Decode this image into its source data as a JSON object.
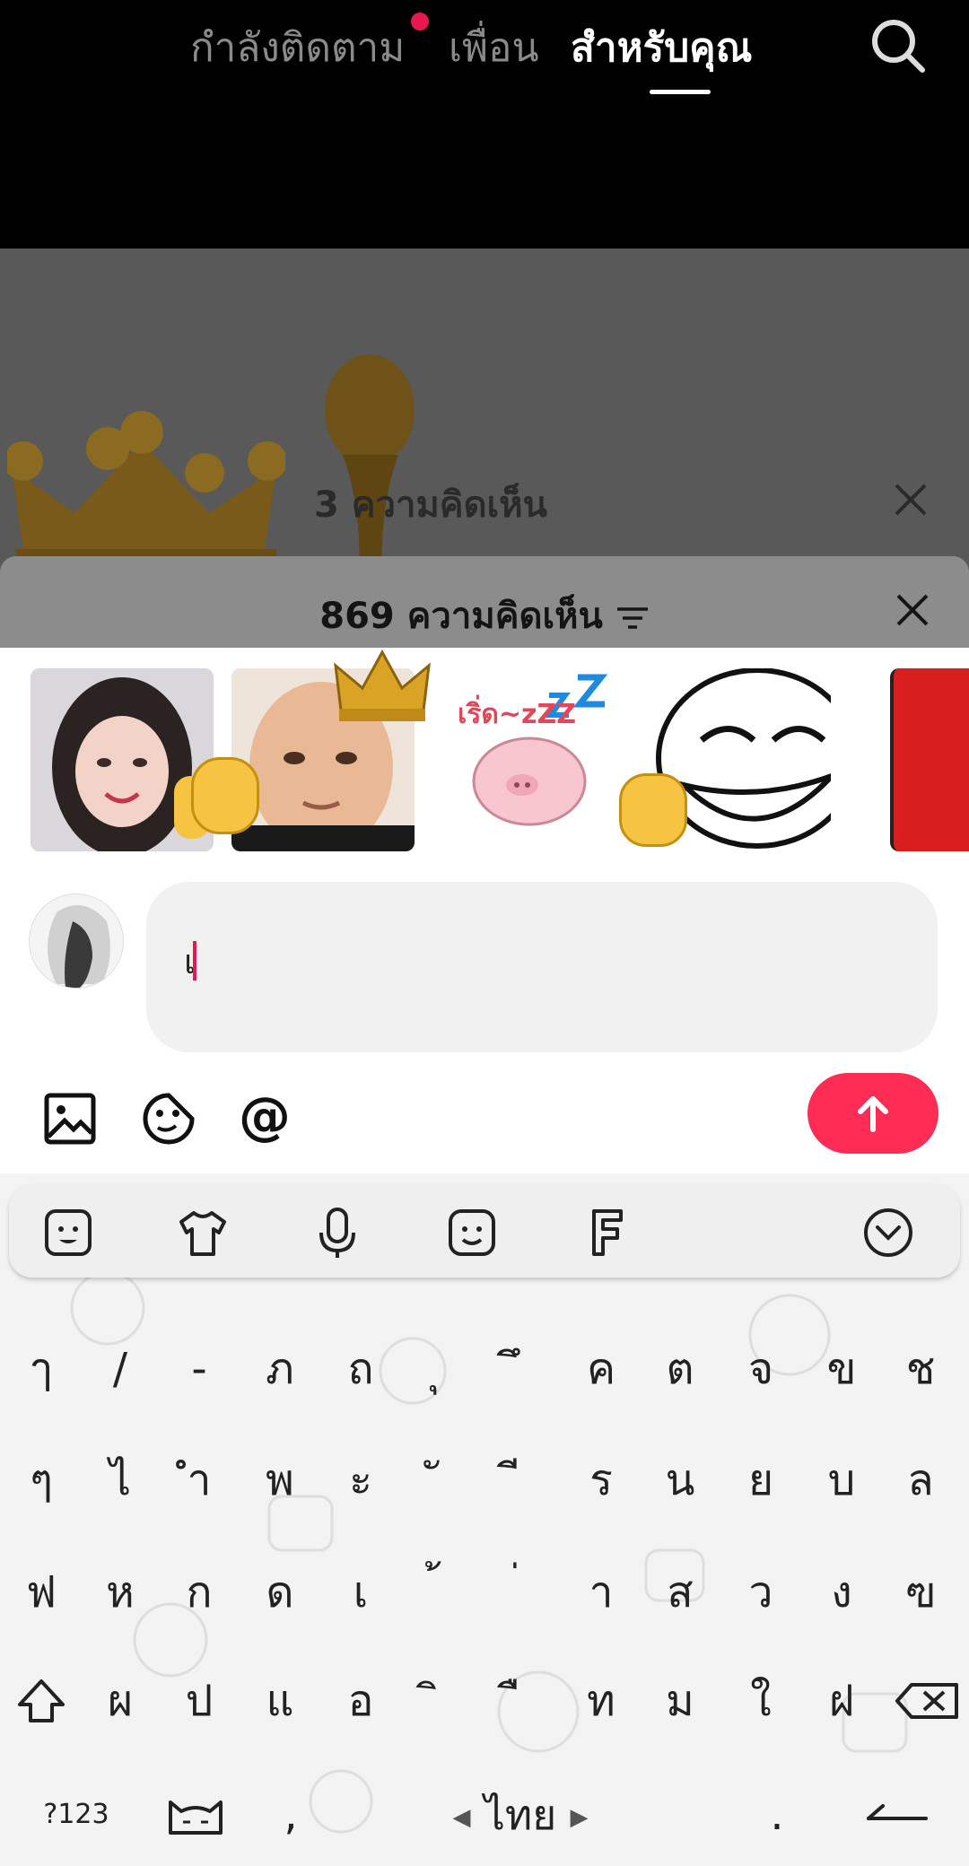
{
  "top_nav": {
    "following": "กำลังติดตาม",
    "friends": "เพื่อน",
    "for_you": "สำหรับคุณ",
    "search_icon": "search-icon"
  },
  "background_sheet": {
    "count_text": "3  ความคิดเห็น"
  },
  "comments_header": {
    "count_text": "869 ความคิดเห็น",
    "sort_icon": "sort-icon",
    "close_icon": "close-icon"
  },
  "stickers": [
    "girl-wave-sticker",
    "crown-face-sticker",
    "sleepy-pig-sticker",
    "troll-face-clap-sticker",
    "red-face-sticker"
  ],
  "sticker_texts": {
    "pig": "เริ่ด~zZZ"
  },
  "comment_input": {
    "value": "เ"
  },
  "composer_tools": [
    "image-icon",
    "emoji-icon",
    "mention-icon"
  ],
  "composer": {
    "mention": "@",
    "send_icon": "arrow-up-icon",
    "send_color": "#fe2c55"
  },
  "keyboard": {
    "toolbar": [
      "sticker-face-icon",
      "shirt-icon",
      "microphone-icon",
      "emoji-face-icon",
      "font-icon",
      "collapse-icon"
    ],
    "rows": [
      [
        "ๅ",
        "/",
        "-",
        "ภ",
        "ถ",
        "ุ",
        "ึ",
        "ค",
        "ต",
        "จ",
        "ข",
        "ช"
      ],
      [
        "ๆ",
        "ไ",
        "ำ",
        "พ",
        "ะ",
        "ั",
        "ี",
        "ร",
        "น",
        "ย",
        "บ",
        "ล"
      ],
      [
        "ฟ",
        "ห",
        "ก",
        "ด",
        "เ",
        "้",
        "่",
        "า",
        "ส",
        "ว",
        "ง",
        "ฃ"
      ],
      [
        "ผ",
        "ป",
        "แ",
        "อ",
        "ิ",
        "ื",
        "ท",
        "ม",
        "ใ",
        "ฝ"
      ]
    ],
    "bottom": {
      "symbols": "?123",
      "comma": ",",
      "language": "ไทย",
      "period": "."
    }
  }
}
